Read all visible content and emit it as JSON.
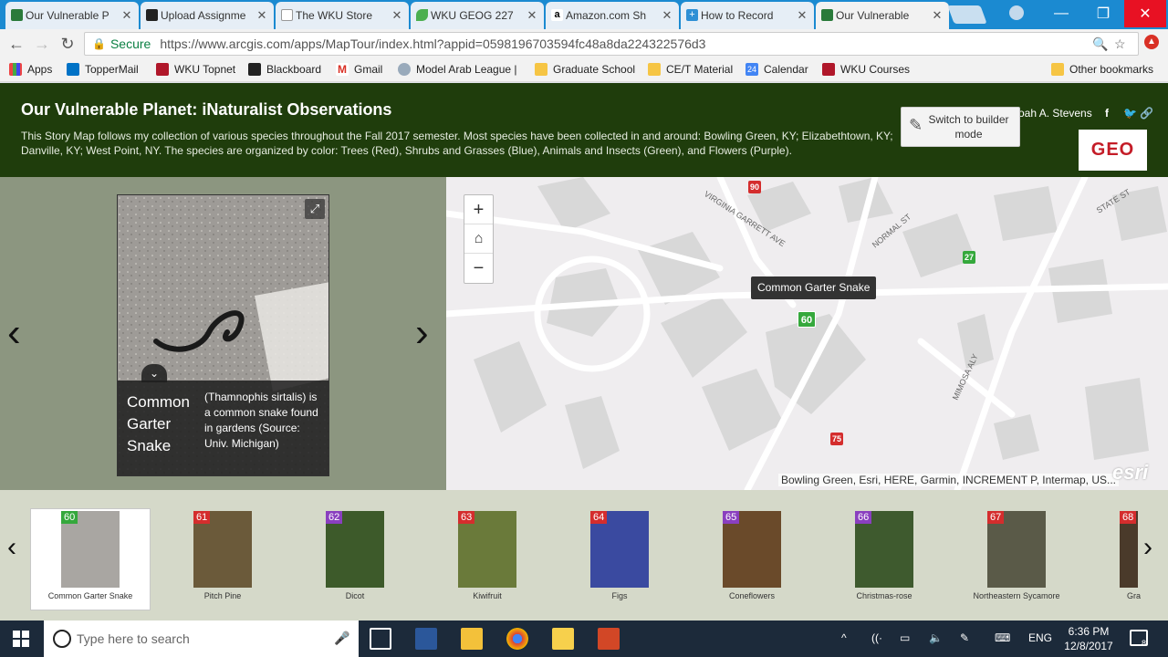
{
  "browser": {
    "tabs": [
      {
        "title": "Our Vulnerable P",
        "icon": "globe-icon"
      },
      {
        "title": "Upload Assignme",
        "icon": "blackboard-icon"
      },
      {
        "title": "The WKU Store",
        "icon": "page-icon"
      },
      {
        "title": "WKU GEOG 227",
        "icon": "leaf-icon"
      },
      {
        "title": "Amazon.com Sh",
        "icon": "amazon-icon"
      },
      {
        "title": "How to Record",
        "icon": "plus-icon"
      },
      {
        "title": "Our Vulnerable",
        "icon": "globe-icon"
      }
    ],
    "secure_label": "Secure",
    "url": "https://www.arcgis.com/apps/MapTour/index.html?appid=0598196703594fc48a8da224322576d3",
    "bookmarks": [
      "Apps",
      "TopperMail",
      "WKU Topnet",
      "Blackboard",
      "Gmail",
      "Model Arab League |",
      "Graduate School",
      "CE/T Material",
      "Calendar",
      "WKU Courses"
    ],
    "other_bookmarks": "Other bookmarks"
  },
  "app": {
    "title": "Our Vulnerable Planet: iNaturalist Observations",
    "description": "This Story Map follows my collection of various species throughout the Fall 2017 semester. Most species have been collected in and around: Bowling Green, KY; Elizabethtown, KY; Danville, KY; West Point, NY. The species are organized by color: Trees (Red), Shrubs and Grasses (Blue), Animals and Insects (Green), and Flowers (Purple).",
    "author": "oah A. Stevens",
    "builder_label": "Switch to builder mode",
    "logo_text": "GEO"
  },
  "detail": {
    "name": "Common Garter Snake",
    "text": "(Thamnophis sirtalis) is a common snake found in gardens (Source: Univ. Michigan)"
  },
  "map": {
    "tooltip": "Common Garter Snake",
    "attribution": "Bowling Green, Esri, HERE, Garmin, INCREMENT P, Intermap, US...",
    "esri_logo": "esri",
    "streets": [
      "VIRGINIA GARRETT AVE",
      "NORMAL ST",
      "STATE ST",
      "MIMOSA ALY"
    ],
    "pins": [
      {
        "num": "90",
        "color": "#d42d2d"
      },
      {
        "num": "27",
        "color": "#35a83c"
      },
      {
        "num": "60",
        "color": "#35a83c"
      },
      {
        "num": "75",
        "color": "#d42d2d"
      }
    ]
  },
  "carousel": [
    {
      "num": "60",
      "label": "Common Garter Snake",
      "color": "#35a83c"
    },
    {
      "num": "61",
      "label": "Pitch Pine",
      "color": "#d42d2d"
    },
    {
      "num": "62",
      "label": "Dicot",
      "color": "#8a3fbf"
    },
    {
      "num": "63",
      "label": "Kiwifruit",
      "color": "#d42d2d"
    },
    {
      "num": "64",
      "label": "Figs",
      "color": "#d42d2d"
    },
    {
      "num": "65",
      "label": "Coneflowers",
      "color": "#8a3fbf"
    },
    {
      "num": "66",
      "label": "Christmas-rose",
      "color": "#8a3fbf"
    },
    {
      "num": "67",
      "label": "Northeastern Sycamore",
      "color": "#d42d2d"
    },
    {
      "num": "68",
      "label": "Gra",
      "color": "#d42d2d"
    }
  ],
  "taskbar": {
    "search_placeholder": "Type here to search",
    "lang": "ENG",
    "time": "6:36 PM",
    "date": "12/8/2017",
    "notification_count": "8"
  }
}
